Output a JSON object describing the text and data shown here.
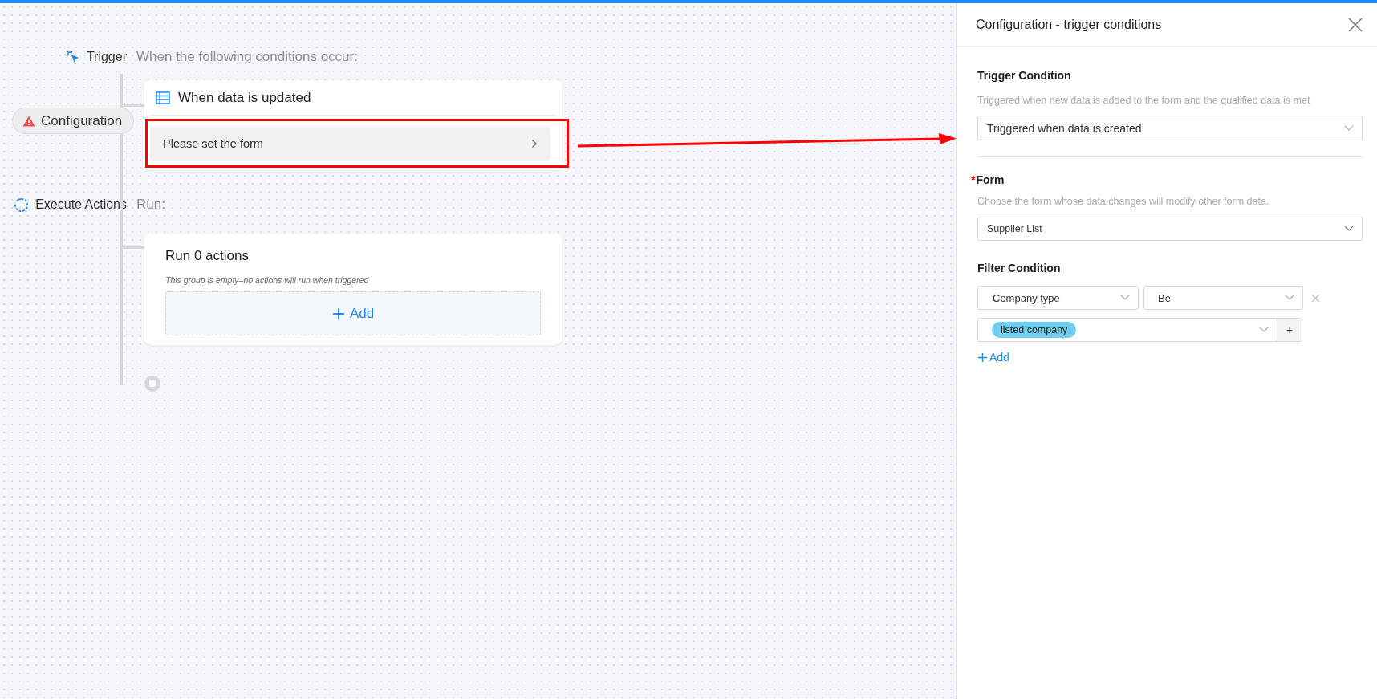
{
  "workflow": {
    "trigger": {
      "label": "Trigger",
      "caption": "When the following conditions occur:",
      "card_title": "When data is updated",
      "form_prompt": "Please set the form"
    },
    "configuration": {
      "label": "Configuration",
      "warning": true
    },
    "actions": {
      "label": "Execute Actions",
      "caption": "Run:",
      "card_title": "Run 0 actions",
      "empty_note": "This group is empty–no actions will run when triggered",
      "add_button": "Add"
    }
  },
  "panel": {
    "title": "Configuration - trigger conditions",
    "trigger_condition": {
      "label": "Trigger Condition",
      "hint": "Triggered when new data is added to the form and the qualified data is met",
      "value": "Triggered when data is created"
    },
    "form": {
      "label": "Form",
      "required": true,
      "required_mark": "*",
      "hint": "Choose the form whose data changes will modify other form data.",
      "value": "Supplier List"
    },
    "filter": {
      "label": "Filter Condition",
      "field": "Company type",
      "operator": "Be",
      "values": [
        "listed company"
      ],
      "value_add": "+",
      "add_button": "Add"
    }
  }
}
